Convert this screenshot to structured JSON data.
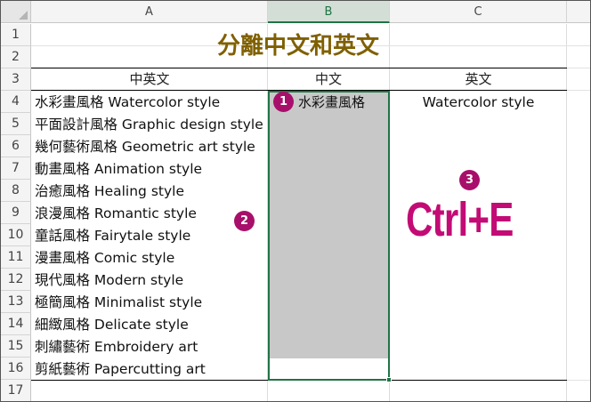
{
  "columns": [
    {
      "label": "A",
      "selected": false
    },
    {
      "label": "B",
      "selected": true
    },
    {
      "label": "C",
      "selected": false
    }
  ],
  "rows": [
    "1",
    "2",
    "3",
    "4",
    "5",
    "6",
    "7",
    "8",
    "9",
    "10",
    "11",
    "12",
    "13",
    "14",
    "15",
    "16",
    "17"
  ],
  "title": "分離中文和英文",
  "headers": {
    "a": "中英文",
    "b": "中文",
    "c": "英文"
  },
  "items": [
    "水彩畫風格 Watercolor style",
    "平面設計風格 Graphic design style",
    "幾何藝術風格 Geometric art style",
    "動畫風格 Animation style",
    "治癒風格 Healing style",
    "浪漫風格 Romantic style",
    "童話風格 Fairytale style",
    "漫畫風格 Comic style",
    "現代風格 Modern style",
    "極簡風格 Minimalist style",
    "細緻風格 Delicate style",
    "刺繡藝術 Embroidery art",
    "剪紙藝術 Papercutting art"
  ],
  "cells": {
    "b4": "水彩畫風格",
    "c4": "Watercolor style"
  },
  "badges": {
    "one": "1",
    "two": "2",
    "three": "3"
  },
  "shortcut": "Ctrl+E",
  "colors": {
    "title": "#7f6000",
    "accent": "#c30b75",
    "badge": "#a80f6a",
    "selection": "#217346"
  }
}
